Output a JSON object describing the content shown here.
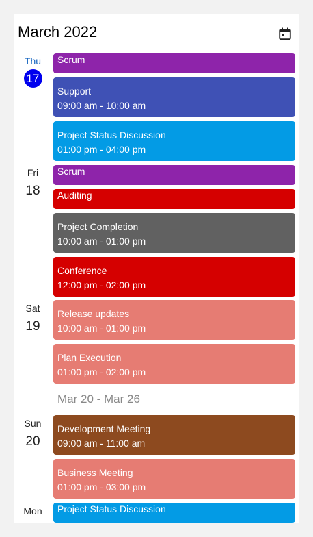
{
  "header": {
    "title": "March 2022",
    "calendar_icon": "calendar-icon"
  },
  "days": [
    {
      "dow": "Thu",
      "date": "17",
      "today": true,
      "events": [
        {
          "title": "Scrum",
          "time": "",
          "color": "#8e24aa"
        },
        {
          "title": "Support",
          "time": "09:00 am - 10:00 am",
          "color": "#3f51b5"
        },
        {
          "title": "Project Status Discussion",
          "time": "01:00 pm - 04:00 pm",
          "color": "#039be5"
        }
      ]
    },
    {
      "dow": "Fri",
      "date": "18",
      "today": false,
      "events": [
        {
          "title": "Scrum",
          "time": "",
          "color": "#8e24aa"
        },
        {
          "title": "Auditing",
          "time": "",
          "color": "#d50000"
        },
        {
          "title": "Project Completion",
          "time": "10:00 am - 01:00 pm",
          "color": "#616161"
        },
        {
          "title": "Conference",
          "time": "12:00 pm - 02:00 pm",
          "color": "#d50000"
        }
      ]
    },
    {
      "dow": "Sat",
      "date": "19",
      "today": false,
      "events": [
        {
          "title": "Release updates",
          "time": "10:00 am - 01:00 pm",
          "color": "#e67c73"
        },
        {
          "title": "Plan Execution",
          "time": "01:00 pm - 02:00 pm",
          "color": "#e67c73"
        }
      ]
    },
    {
      "dow": "Sun",
      "date": "20",
      "today": false,
      "events": [
        {
          "title": "Development Meeting",
          "time": "09:00 am - 11:00 am",
          "color": "#8d4a1f"
        },
        {
          "title": "Business Meeting",
          "time": "01:00 pm - 03:00 pm",
          "color": "#e67c73"
        }
      ]
    },
    {
      "dow": "Mon",
      "date": "",
      "today": false,
      "events": [
        {
          "title": "Project Status Discussion",
          "time": "",
          "color": "#039be5"
        }
      ]
    }
  ],
  "week_header": "Mar 20 - Mar 26"
}
